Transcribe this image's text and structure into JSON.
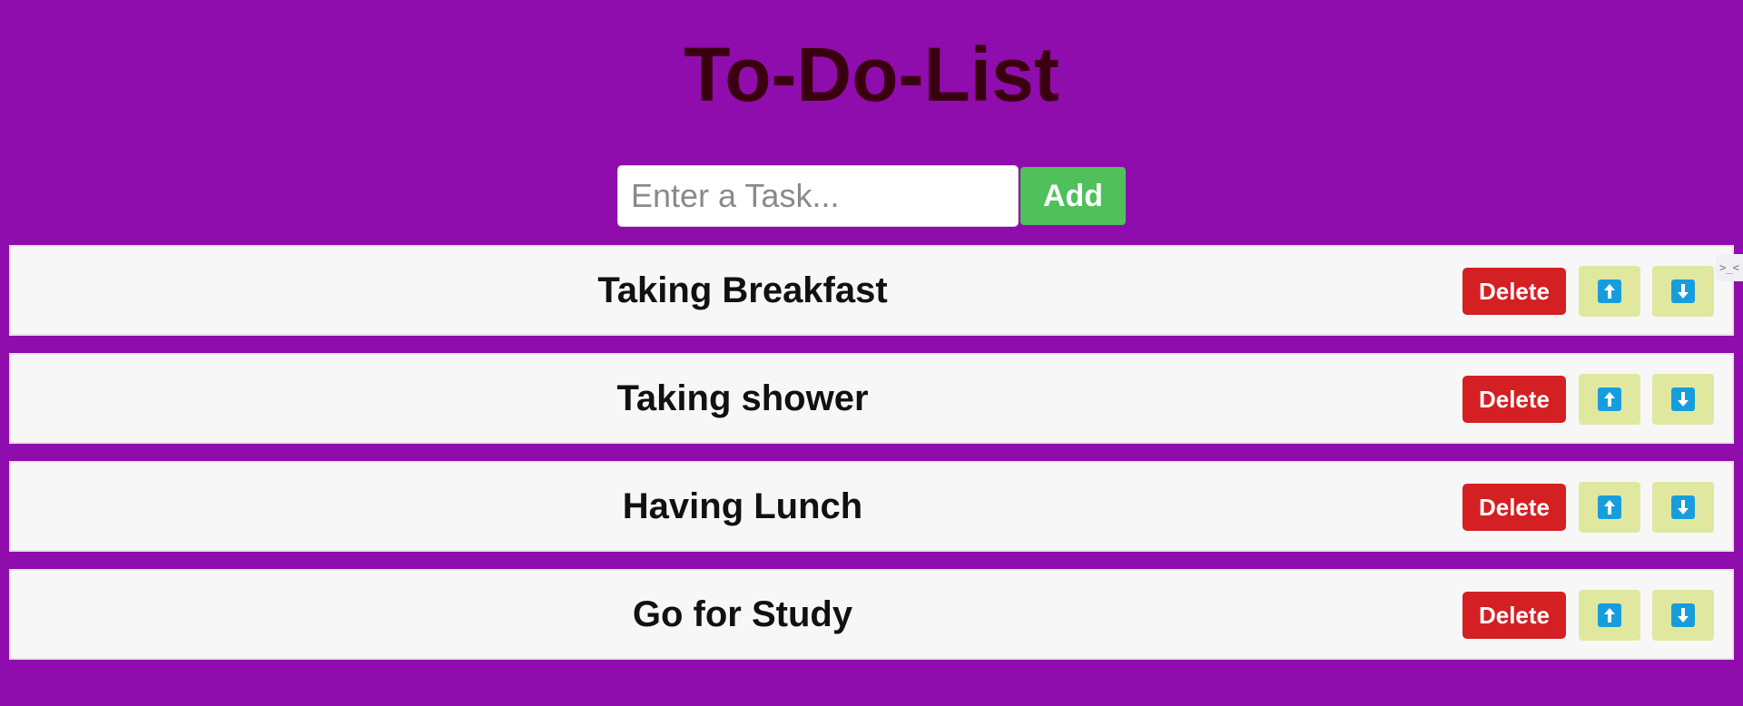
{
  "header": {
    "title": "To-Do-List"
  },
  "add_form": {
    "input_placeholder": "Enter a Task...",
    "input_value": "",
    "add_label": "Add"
  },
  "tasks": [
    {
      "text": "Taking Breakfast",
      "delete_label": "Delete",
      "up_icon": "arrow-up-icon",
      "down_icon": "arrow-down-icon"
    },
    {
      "text": "Taking shower",
      "delete_label": "Delete",
      "up_icon": "arrow-up-icon",
      "down_icon": "arrow-down-icon"
    },
    {
      "text": "Having Lunch",
      "delete_label": "Delete",
      "up_icon": "arrow-up-icon",
      "down_icon": "arrow-down-icon"
    },
    {
      "text": "Go for Study",
      "delete_label": "Delete",
      "up_icon": "arrow-up-icon",
      "down_icon": "arrow-down-icon"
    }
  ],
  "corner_widget": {
    "icon": "collapse-icon",
    "label": ">_<"
  },
  "colors": {
    "background": "#8e0dac",
    "title": "#3b0010",
    "add_button": "#4fc05a",
    "delete_button": "#d41f23",
    "move_button": "#e0e8a0",
    "arrow_icon": "#169edc",
    "row_background": "#f7f7f7"
  }
}
